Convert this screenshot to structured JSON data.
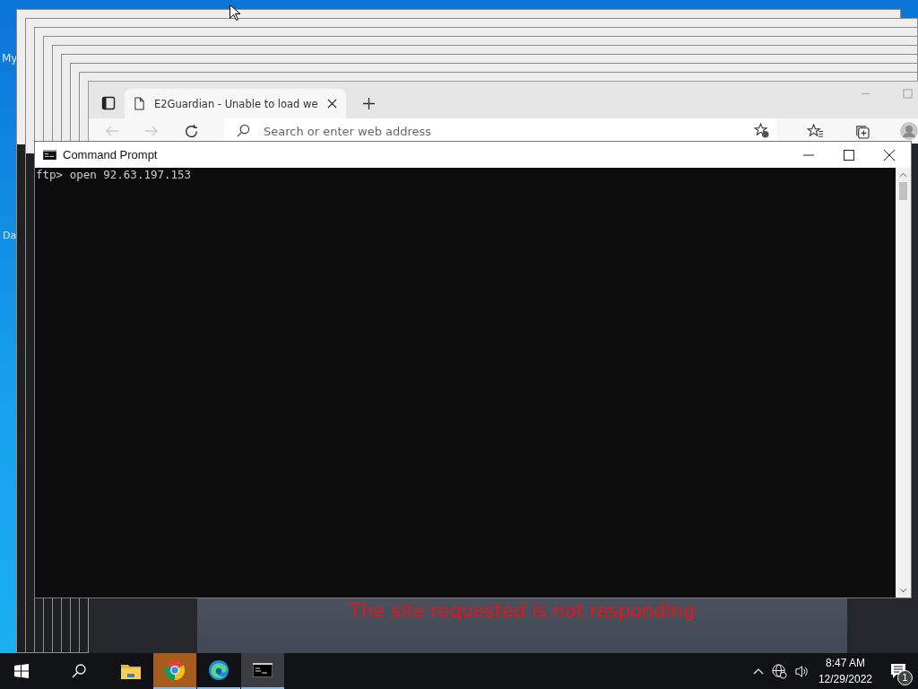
{
  "desktop": {
    "icon_labels": [
      "My",
      "Da"
    ]
  },
  "browser": {
    "tab": {
      "title": "E2Guardian - Unable to load we"
    },
    "address_bar": {
      "placeholder": "Search or enter web address"
    },
    "page": {
      "message": "The site requested is not responding"
    }
  },
  "command_prompt": {
    "title": "Command Prompt",
    "lines": [
      "ftp> open 92.63.197.153"
    ]
  },
  "taskbar": {
    "apps": [
      {
        "kind": "explorer",
        "running": false,
        "flashing": false,
        "selected": false
      },
      {
        "kind": "chrome",
        "running": true,
        "flashing": true,
        "selected": false
      },
      {
        "kind": "edge",
        "running": true,
        "flashing": false,
        "selected": false
      },
      {
        "kind": "console",
        "running": true,
        "flashing": false,
        "selected": true
      }
    ],
    "time": "8:47 AM",
    "date": "12/29/2022",
    "notification_count": "1"
  }
}
